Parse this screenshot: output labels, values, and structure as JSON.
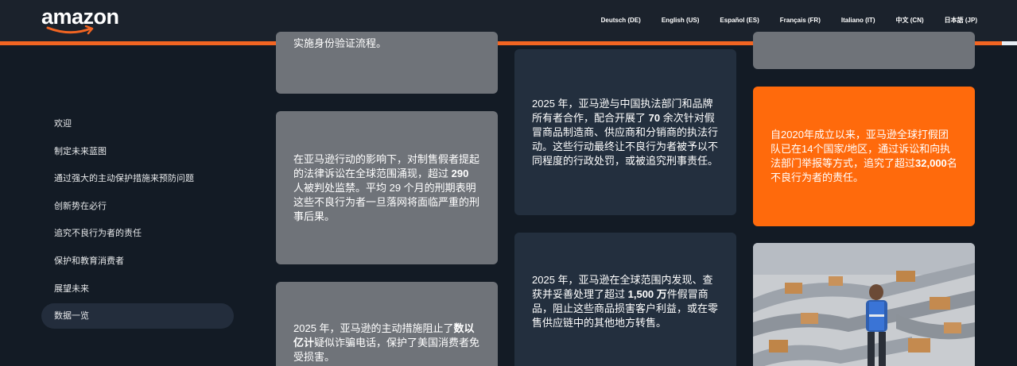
{
  "header": {
    "logo_text": "amazon",
    "languages": [
      "Deutsch (DE)",
      "English (US)",
      "Español (ES)",
      "Français (FR)",
      "Italiano (IT)",
      "中文 (CN)",
      "日本語 (JP)"
    ],
    "accent_color": "#f26522"
  },
  "sidebar": {
    "items": [
      "欢迎",
      "制定未来蓝图",
      "通过强大的主动保护措施来预防问题",
      "创新势在必行",
      "追究不良行为者的责任",
      "保护和教育消费者",
      "展望未来",
      "数据一览"
    ],
    "active_index": 7
  },
  "cards": {
    "col1_top_partial": "实施身份验证流程。",
    "col1_mid": {
      "p1": "在亚马逊行动的影响下，对制售假者提起的法律诉讼在全球范围涌现，超过 ",
      "b1": "290",
      "p2": " 人被判处监禁。平均 29 个月的刑期表明这些不良行为者一旦落网将面临严重的刑事后果。"
    },
    "col1_bottom": {
      "p1": "2025 年，亚马逊的主动措施阻止了",
      "b1": "数以亿计",
      "p2": "疑似诈骗电话，保护了美国消费者免受损害。"
    },
    "col2_top": {
      "p1": "2025 年，亚马逊与中国执法部门和品牌所有者合作，配合开展了 ",
      "b1": "70",
      "p2": " 余次针对假冒商品制造商、供应商和分销商的执法行动。这些行动最终让不良行为者被予以不同程度的行政处罚，或被追究刑事责任。"
    },
    "col2_bottom": {
      "p1": "2025 年，亚马逊在全球范围内发现、查获并妥善处理了超过 ",
      "b1": "1,500 万",
      "p2": "件假冒商品，阻止这些商品损害客户利益，或在零售供应链中的其他地方转售。"
    },
    "col3_orange": {
      "p1": "自2020年成立以来，亚马逊全球打假团队已在14个国家/地区，通过诉讼和向执法部门举报等方式，追究了超过",
      "b1": "32,000",
      "p2": "名不良行为者的责任。"
    }
  },
  "colors": {
    "background": "#131b25",
    "gray_card": "#6f7379",
    "navy_card": "#232f3e",
    "orange_card": "#ff6a0c"
  }
}
